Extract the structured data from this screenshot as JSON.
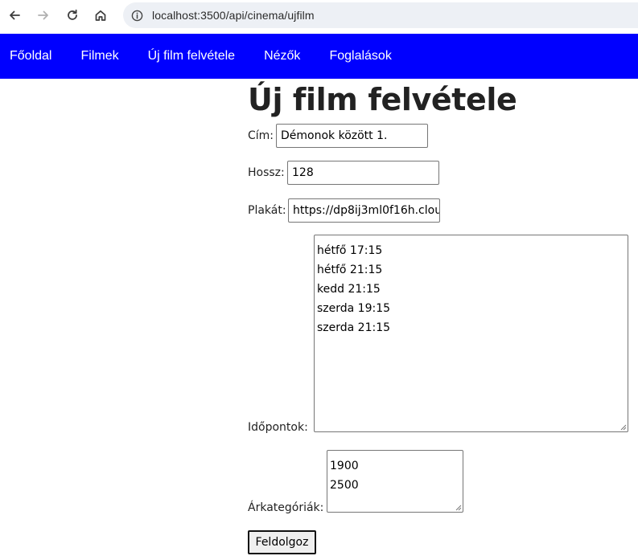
{
  "browser": {
    "url": "localhost:3500/api/cinema/ujfilm"
  },
  "nav": {
    "items": [
      "Főoldal",
      "Filmek",
      "Új film felvétele",
      "Nézők",
      "Foglalások"
    ]
  },
  "form": {
    "title": "Új film felvétele",
    "cim_label": "Cím:",
    "cim_value": "Démonok között 1.",
    "hossz_label": "Hossz:",
    "hossz_value": "128",
    "plakat_label": "Plakát:",
    "plakat_value": "https://dp8ij3ml0f16h.clou",
    "idopontok_label": "Időpontok:",
    "idopontok_lines": [
      "hétfő 17:15",
      "hétfő 21:15",
      "kedd 21:15",
      "szerda 19:15",
      "szerda 21:15"
    ],
    "arkategoriak_label": "Árkategóriák:",
    "arkategoriak_lines": [
      "1900",
      "2500"
    ],
    "submit_label": "Feldolgoz"
  },
  "colors": {
    "nav_background": "#0000ff",
    "nav_text": "#ffffff",
    "address_bar": "#edf0f5"
  }
}
